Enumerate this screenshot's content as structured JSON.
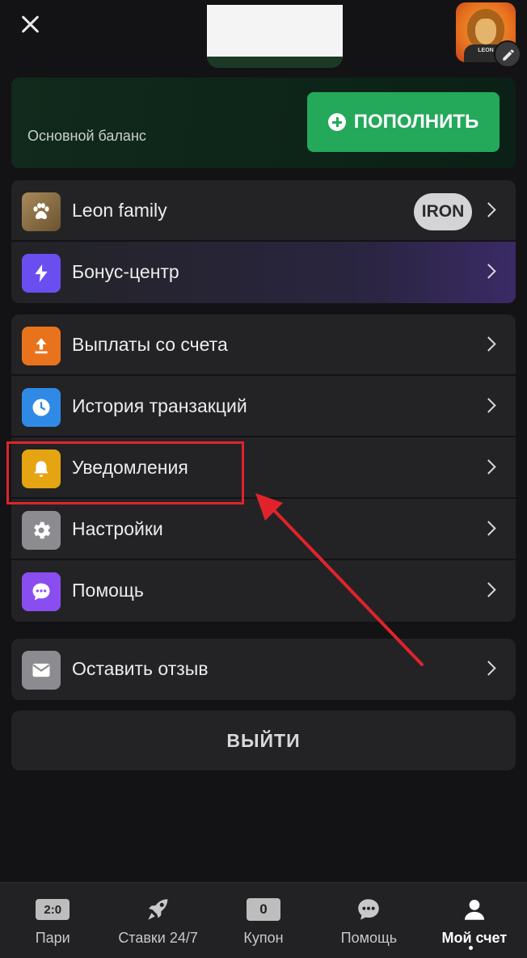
{
  "header": {
    "close_icon": "close-icon",
    "avatar_text": "LEON",
    "edit_icon": "pencil-icon"
  },
  "balance": {
    "label": "Основной баланс",
    "topup_label": "ПОПОЛНИТЬ",
    "topup_icon": "plus-circle-icon",
    "accent": "#24a85a"
  },
  "menu_group_1": [
    {
      "label": "Leon family",
      "icon": "paw-icon",
      "badge": "IRON"
    },
    {
      "label": "Бонус-центр",
      "icon": "lightning-icon"
    }
  ],
  "menu_group_2": [
    {
      "label": "Выплаты со счета",
      "icon": "upload-icon"
    },
    {
      "label": "История транзакций",
      "icon": "clock-icon"
    },
    {
      "label": "Уведомления",
      "icon": "bell-icon"
    },
    {
      "label": "Настройки",
      "icon": "gear-icon"
    },
    {
      "label": "Помощь",
      "icon": "chat-icon"
    }
  ],
  "menu_group_3": [
    {
      "label": "Оставить отзыв",
      "icon": "mail-icon"
    }
  ],
  "logout_label": "ВЫЙТИ",
  "annotation": {
    "color": "#e0232b"
  },
  "tabbar": [
    {
      "label": "Пари",
      "icon_text": "2:0"
    },
    {
      "label": "Ставки 24/7",
      "icon": "rocket-icon"
    },
    {
      "label": "Купон",
      "icon_text": "0"
    },
    {
      "label": "Помощь",
      "icon": "chat-bubble-icon"
    },
    {
      "label": "Мой счет",
      "icon": "user-icon",
      "active": true
    }
  ]
}
